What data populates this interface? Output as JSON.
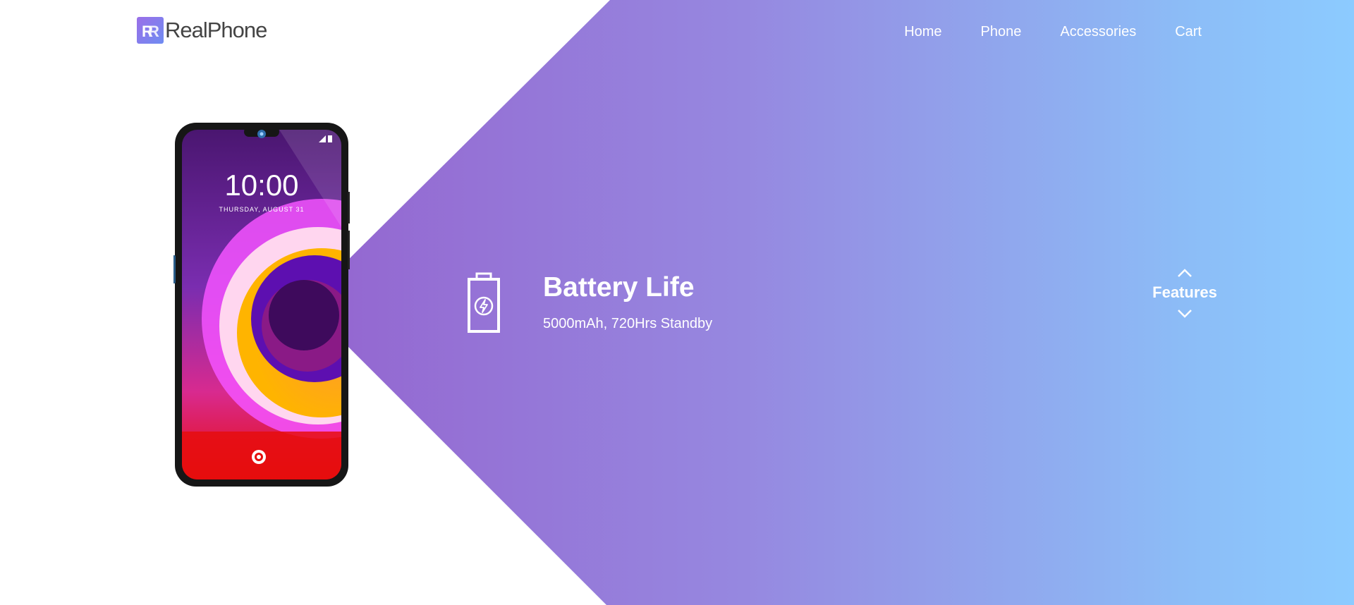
{
  "brand": {
    "name": "RealPhone",
    "accent": "#9b5ac8"
  },
  "nav": {
    "items": [
      "Home",
      "Phone",
      "Accessories",
      "Cart"
    ]
  },
  "phone_screen": {
    "time": "10:00",
    "date": "THURSDAY, AUGUST 31"
  },
  "feature": {
    "title": "Battery Life",
    "description": "5000mAh, 720Hrs Standby",
    "icon": "battery-charging-icon"
  },
  "features_nav": {
    "label": "Features",
    "prev_icon": "chevron-up-icon",
    "next_icon": "chevron-down-icon"
  },
  "colors": {
    "gradient_start": "#9b5ac8",
    "gradient_end": "#8ccbff"
  }
}
